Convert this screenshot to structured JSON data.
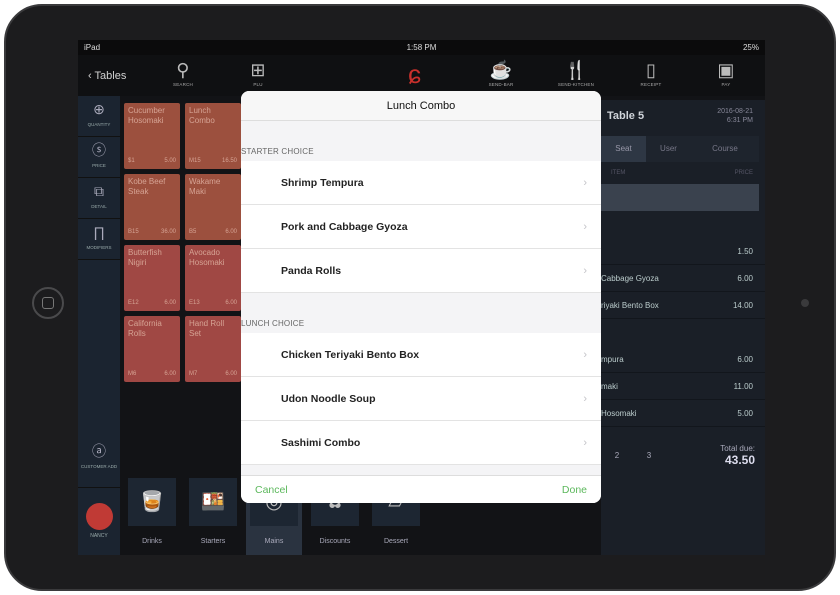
{
  "status": {
    "device": "iPad",
    "time": "1:58 PM",
    "battery": "25%"
  },
  "nav": {
    "back": "Tables",
    "buttons": [
      {
        "label": "SEARCH",
        "icon": "search-icon"
      },
      {
        "label": "PLU",
        "icon": "grid-icon"
      },
      {
        "label": "SEND-BAR",
        "icon": "mug-icon"
      },
      {
        "label": "SEND-KITCHEN",
        "icon": "utensils-icon"
      },
      {
        "label": "RECEIPT",
        "icon": "receipt-icon"
      },
      {
        "label": "PAY",
        "icon": "register-icon"
      }
    ]
  },
  "sidebar": {
    "items": [
      {
        "label": "QUANTITY"
      },
      {
        "label": "PRICE"
      },
      {
        "label": "DETAIL"
      },
      {
        "label": "MODIFIERS"
      }
    ],
    "customer": "CUSTOMER ADD",
    "user": "NANCY"
  },
  "menu": [
    {
      "name": "Cucumber Hosomaki",
      "code": "$1",
      "price": "5.00"
    },
    {
      "name": "Lunch Combo",
      "code": "M15",
      "price": "16.50"
    },
    {
      "name": "Kobe Beef Steak",
      "code": "B15",
      "price": "36.00"
    },
    {
      "name": "Wakame Maki",
      "code": "B5",
      "price": "6.00"
    },
    {
      "name": "Butterfish Nigiri",
      "code": "E12",
      "price": "6.00"
    },
    {
      "name": "Avocado Hosomaki",
      "code": "E13",
      "price": "6.00"
    },
    {
      "name": "California Rolls",
      "code": "M6",
      "price": "6.00"
    },
    {
      "name": "Hand Roll Set",
      "code": "M7",
      "price": "6.00"
    }
  ],
  "categories": [
    "Drinks",
    "Starters",
    "Mains",
    "Discounts",
    "Dessert"
  ],
  "order": {
    "table": "Table 5",
    "date": "2016-08-21",
    "time": "6:31 PM",
    "tabs": [
      "Seat",
      "User",
      "Course"
    ],
    "col_item": "ITEM",
    "col_price": "PRICE",
    "rows": [
      {
        "name": "",
        "price": "1.50"
      },
      {
        "name": "Cabbage Gyoza",
        "price": "6.00"
      },
      {
        "name": "riyaki Bento Box",
        "price": "14.00"
      },
      {
        "name": "mpura",
        "price": "6.00"
      },
      {
        "name": "maki",
        "price": "11.00"
      },
      {
        "name": "Hosomaki",
        "price": "5.00"
      }
    ],
    "pages": [
      "2",
      "3"
    ],
    "total_label": "Total due:",
    "total": "43.50"
  },
  "modal": {
    "title": "Lunch Combo",
    "sections": [
      {
        "title": "STARTER CHOICE",
        "items": [
          "Shrimp Tempura",
          "Pork and Cabbage Gyoza",
          "Panda Rolls"
        ]
      },
      {
        "title": "LUNCH CHOICE",
        "items": [
          "Chicken Teriyaki Bento Box",
          "Udon Noodle Soup",
          "Sashimi Combo"
        ]
      }
    ],
    "cancel": "Cancel",
    "done": "Done"
  },
  "colors": {
    "accent": "#5cb85c",
    "brand": "#c8302c",
    "tile": "#9c503e"
  }
}
